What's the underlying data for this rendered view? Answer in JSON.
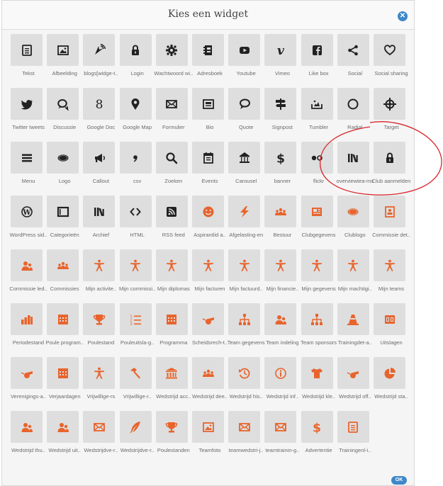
{
  "dialog": {
    "title": "Kies een widget",
    "close_icon": "close-icon",
    "ok_label": "OK"
  },
  "colors": {
    "tile_bg": "#dedede",
    "dark_icon": "#222222",
    "orange_icon": "#e8642c",
    "accent_blue": "#3d88c9",
    "annotation_red": "#d9262b"
  },
  "widgets": [
    {
      "label": "Tekst",
      "icon": "document-icon",
      "tone": "dark"
    },
    {
      "label": "Afbeelding",
      "icon": "image-icon",
      "tone": "dark"
    },
    {
      "label": "blogs[widge-t..",
      "icon": "rss-feed-icon",
      "tone": "dark"
    },
    {
      "label": "Login",
      "icon": "lock-icon",
      "tone": "dark"
    },
    {
      "label": "Wachtwoord wi..",
      "icon": "gear-icon",
      "tone": "dark"
    },
    {
      "label": "Adresboek",
      "icon": "address-book-icon",
      "tone": "dark"
    },
    {
      "label": "Youtube",
      "icon": "youtube-icon",
      "tone": "dark"
    },
    {
      "label": "Vimeo",
      "icon": "vimeo-icon",
      "tone": "dark"
    },
    {
      "label": "Like box",
      "icon": "facebook-icon",
      "tone": "dark"
    },
    {
      "label": "Social",
      "icon": "share-icon",
      "tone": "dark"
    },
    {
      "label": "Social sharing",
      "icon": "heart-icon",
      "tone": "dark"
    },
    {
      "label": "Twitter tweets",
      "icon": "twitter-icon",
      "tone": "dark"
    },
    {
      "label": "Discussie",
      "icon": "discussion-icon",
      "tone": "dark"
    },
    {
      "label": "Google Doc",
      "icon": "google-icon",
      "tone": "dark"
    },
    {
      "label": "Google Map",
      "icon": "map-pin-icon",
      "tone": "dark"
    },
    {
      "label": "Formulier",
      "icon": "envelope-icon",
      "tone": "dark"
    },
    {
      "label": "Bio",
      "icon": "id-card-icon",
      "tone": "dark"
    },
    {
      "label": "Quote",
      "icon": "speech-bubble-icon",
      "tone": "dark"
    },
    {
      "label": "Signpost",
      "icon": "signpost-icon",
      "tone": "dark"
    },
    {
      "label": "Tumbler",
      "icon": "tumbler-icon",
      "tone": "dark"
    },
    {
      "label": "Radial",
      "icon": "circle-icon",
      "tone": "dark"
    },
    {
      "label": "Target",
      "icon": "target-icon",
      "tone": "dark"
    },
    {
      "label": "Menu",
      "icon": "menu-icon",
      "tone": "dark"
    },
    {
      "label": "Logo",
      "icon": "ellipse-icon",
      "tone": "dark"
    },
    {
      "label": "Callout",
      "icon": "megaphone-icon",
      "tone": "dark"
    },
    {
      "label": "csv",
      "icon": "comma-icon",
      "tone": "dark"
    },
    {
      "label": "Zoeken",
      "icon": "search-icon",
      "tone": "dark"
    },
    {
      "label": "Events",
      "icon": "calendar-icon",
      "tone": "dark"
    },
    {
      "label": "Carousel",
      "icon": "carousel-icon",
      "tone": "dark"
    },
    {
      "label": "banner",
      "icon": "dollar-icon",
      "tone": "dark"
    },
    {
      "label": "flickr",
      "icon": "flickr-icon",
      "tone": "dark"
    },
    {
      "label": "overviewtea-ms",
      "icon": "library-icon",
      "tone": "dark"
    },
    {
      "label": "Club aanmelden",
      "icon": "lock-icon",
      "tone": "dark"
    },
    {
      "label": "WordPress sid..",
      "icon": "wordpress-icon",
      "tone": "dark"
    },
    {
      "label": "Categorieën",
      "icon": "square-icon",
      "tone": "dark"
    },
    {
      "label": "Archief",
      "icon": "library-icon",
      "tone": "dark"
    },
    {
      "label": "HTML",
      "icon": "code-icon",
      "tone": "dark"
    },
    {
      "label": "RSS feed",
      "icon": "rss-icon",
      "tone": "dark"
    },
    {
      "label": "Aspirantlid a..",
      "icon": "smiley-icon",
      "tone": "orange"
    },
    {
      "label": "Afgelasting-en",
      "icon": "lightning-icon",
      "tone": "orange"
    },
    {
      "label": "Bestuur",
      "icon": "group-icon",
      "tone": "orange"
    },
    {
      "label": "Clubgegevens",
      "icon": "newspaper-icon",
      "tone": "orange"
    },
    {
      "label": "Clublogo",
      "icon": "ellipse-icon",
      "tone": "orange"
    },
    {
      "label": "Commissie det..",
      "icon": "contact-card-icon",
      "tone": "orange"
    },
    {
      "label": "Commissie led..",
      "icon": "people-icon",
      "tone": "orange"
    },
    {
      "label": "Commissies",
      "icon": "group-icon",
      "tone": "orange"
    },
    {
      "label": "Mijn activite..",
      "icon": "person-icon",
      "tone": "orange"
    },
    {
      "label": "Mijn commissi..",
      "icon": "person-icon",
      "tone": "orange"
    },
    {
      "label": "Mijn diplomas",
      "icon": "person-icon",
      "tone": "orange"
    },
    {
      "label": "Mijn facturen",
      "icon": "person-icon",
      "tone": "orange"
    },
    {
      "label": "Mijn factuurd..",
      "icon": "person-icon",
      "tone": "orange"
    },
    {
      "label": "Mijn financie..",
      "icon": "person-icon",
      "tone": "orange"
    },
    {
      "label": "Mijn gegevens",
      "icon": "person-icon",
      "tone": "orange"
    },
    {
      "label": "Mijn machtigi..",
      "icon": "person-icon",
      "tone": "orange"
    },
    {
      "label": "Mijn teams",
      "icon": "person-icon",
      "tone": "orange"
    },
    {
      "label": "Periodestand",
      "icon": "bar-chart-icon",
      "tone": "orange"
    },
    {
      "label": "Poule program..",
      "icon": "calendar-grid-icon",
      "tone": "orange"
    },
    {
      "label": "Poulestand",
      "icon": "trophy-icon",
      "tone": "orange"
    },
    {
      "label": "Pouleuitsla-g..",
      "icon": "numbered-list-icon",
      "tone": "orange"
    },
    {
      "label": "Programma",
      "icon": "calendar-grid-icon",
      "tone": "orange"
    },
    {
      "label": "Scheidsrech-t..",
      "icon": "whistle-icon",
      "tone": "orange"
    },
    {
      "label": "Team gegevens",
      "icon": "org-chart-icon",
      "tone": "orange"
    },
    {
      "label": "Team indeling",
      "icon": "people-icon",
      "tone": "orange"
    },
    {
      "label": "Team sponsors",
      "icon": "org-chart-icon",
      "tone": "orange"
    },
    {
      "label": "Trainingdet-a..",
      "icon": "cone-icon",
      "tone": "orange"
    },
    {
      "label": "Uitslagen",
      "icon": "scoreboard-icon",
      "tone": "orange"
    },
    {
      "label": "Verenigings-a..",
      "icon": "whistle-icon",
      "tone": "orange"
    },
    {
      "label": "Verjaardagen",
      "icon": "calendar-grid-icon",
      "tone": "orange"
    },
    {
      "label": "Vrijwillige-rs",
      "icon": "person-icon",
      "tone": "orange"
    },
    {
      "label": "Vrijwillige-r..",
      "icon": "hammer-icon",
      "tone": "orange"
    },
    {
      "label": "Wedstrijd acc..",
      "icon": "building-icon",
      "tone": "orange"
    },
    {
      "label": "Wedstrijd dee..",
      "icon": "group-icon",
      "tone": "orange"
    },
    {
      "label": "Wedstrijd his..",
      "icon": "history-icon",
      "tone": "orange"
    },
    {
      "label": "Wedstrijd inf..",
      "icon": "info-icon",
      "tone": "orange"
    },
    {
      "label": "Wedstrijd kle..",
      "icon": "shirt-icon",
      "tone": "orange"
    },
    {
      "label": "Wedstrijd off..",
      "icon": "whistle-icon",
      "tone": "orange"
    },
    {
      "label": "Wedstrijd sta..",
      "icon": "pie-chart-icon",
      "tone": "orange"
    },
    {
      "label": "Wedstrijd thu..",
      "icon": "people-icon",
      "tone": "orange"
    },
    {
      "label": "Wedstrijd uit..",
      "icon": "people-icon",
      "tone": "orange"
    },
    {
      "label": "Wedstrijdve-r..",
      "icon": "envelope-icon",
      "tone": "orange"
    },
    {
      "label": "Wedstrijdve-r..",
      "icon": "quill-icon",
      "tone": "orange"
    },
    {
      "label": "Poulestanden",
      "icon": "trophy-icon",
      "tone": "orange"
    },
    {
      "label": "Teamfoto",
      "icon": "image-icon",
      "tone": "orange"
    },
    {
      "label": "teamwedstri-j..",
      "icon": "envelope-icon",
      "tone": "orange"
    },
    {
      "label": "teamtrainin-g..",
      "icon": "envelope-icon",
      "tone": "orange"
    },
    {
      "label": "Advertentie",
      "icon": "dollar-icon",
      "tone": "orange"
    },
    {
      "label": "Trainingenl-i..",
      "icon": "document-icon",
      "tone": "orange"
    }
  ]
}
